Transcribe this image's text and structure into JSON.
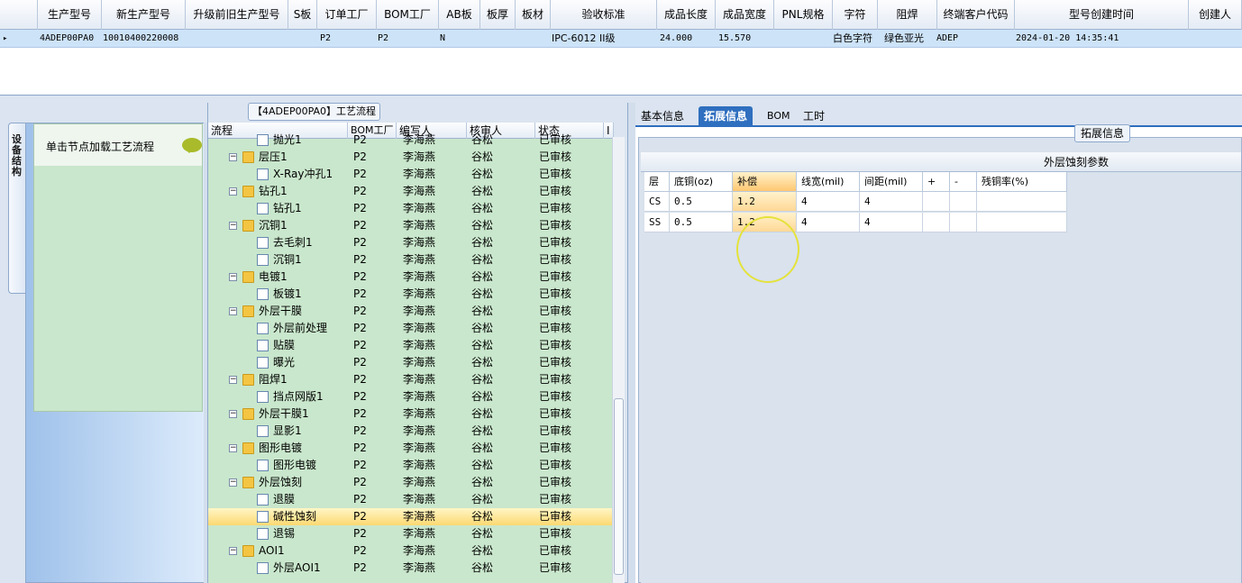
{
  "top_grid": {
    "columns": [
      "生产型号",
      "新生产型号",
      "升级前旧生产型号",
      "S板",
      "订单工厂",
      "BOM工厂",
      "AB板",
      "板厚",
      "板材",
      "验收标准",
      "成品长度",
      "成品宽度",
      "PNL规格",
      "字符",
      "阻焊",
      "终端客户代码",
      "型号创建时间",
      "创建人"
    ],
    "row": [
      "4ADEP00PA0",
      "10010400220008",
      "",
      "",
      "P2",
      "P2",
      "N",
      "",
      "",
      "IPC-6012 II级",
      "24.000",
      "15.570",
      "",
      "白色字符",
      "绿色亚光",
      "ADEP",
      "2024-01-20 14:35:41",
      ""
    ]
  },
  "side_tab": {
    "label": "设备结构"
  },
  "left_pane": {
    "hint": "单击节点加载工艺流程"
  },
  "flow": {
    "title": "【4ADEP00PA0】工艺流程",
    "columns": [
      "流程",
      "BOM工厂",
      "编写人",
      "核审人",
      "状态",
      "I"
    ],
    "rows": [
      {
        "level": 1,
        "name": "抛光1",
        "bom": "P2",
        "writer": "李海燕",
        "reviewer": "谷松",
        "status": "已审核"
      },
      {
        "level": 0,
        "name": "层压1",
        "bom": "P2",
        "writer": "李海燕",
        "reviewer": "谷松",
        "status": "已审核"
      },
      {
        "level": 1,
        "name": "X-Ray冲孔1",
        "bom": "P2",
        "writer": "李海燕",
        "reviewer": "谷松",
        "status": "已审核"
      },
      {
        "level": 0,
        "name": "钻孔1",
        "bom": "P2",
        "writer": "李海燕",
        "reviewer": "谷松",
        "status": "已审核"
      },
      {
        "level": 1,
        "name": "钻孔1",
        "bom": "P2",
        "writer": "李海燕",
        "reviewer": "谷松",
        "status": "已审核"
      },
      {
        "level": 0,
        "name": "沉铜1",
        "bom": "P2",
        "writer": "李海燕",
        "reviewer": "谷松",
        "status": "已审核"
      },
      {
        "level": 1,
        "name": "去毛刺1",
        "bom": "P2",
        "writer": "李海燕",
        "reviewer": "谷松",
        "status": "已审核"
      },
      {
        "level": 1,
        "name": "沉铜1",
        "bom": "P2",
        "writer": "李海燕",
        "reviewer": "谷松",
        "status": "已审核"
      },
      {
        "level": 0,
        "name": "电镀1",
        "bom": "P2",
        "writer": "李海燕",
        "reviewer": "谷松",
        "status": "已审核"
      },
      {
        "level": 1,
        "name": "板镀1",
        "bom": "P2",
        "writer": "李海燕",
        "reviewer": "谷松",
        "status": "已审核"
      },
      {
        "level": 0,
        "name": "外层干膜",
        "bom": "P2",
        "writer": "李海燕",
        "reviewer": "谷松",
        "status": "已审核"
      },
      {
        "level": 1,
        "name": "外层前处理",
        "bom": "P2",
        "writer": "李海燕",
        "reviewer": "谷松",
        "status": "已审核"
      },
      {
        "level": 1,
        "name": "贴膜",
        "bom": "P2",
        "writer": "李海燕",
        "reviewer": "谷松",
        "status": "已审核"
      },
      {
        "level": 1,
        "name": "曝光",
        "bom": "P2",
        "writer": "李海燕",
        "reviewer": "谷松",
        "status": "已审核"
      },
      {
        "level": 0,
        "name": "阻焊1",
        "bom": "P2",
        "writer": "李海燕",
        "reviewer": "谷松",
        "status": "已审核"
      },
      {
        "level": 1,
        "name": "挡点网版1",
        "bom": "P2",
        "writer": "李海燕",
        "reviewer": "谷松",
        "status": "已审核"
      },
      {
        "level": 0,
        "name": "外层干膜1",
        "bom": "P2",
        "writer": "李海燕",
        "reviewer": "谷松",
        "status": "已审核"
      },
      {
        "level": 1,
        "name": "显影1",
        "bom": "P2",
        "writer": "李海燕",
        "reviewer": "谷松",
        "status": "已审核"
      },
      {
        "level": 0,
        "name": "图形电镀",
        "bom": "P2",
        "writer": "李海燕",
        "reviewer": "谷松",
        "status": "已审核"
      },
      {
        "level": 1,
        "name": "图形电镀",
        "bom": "P2",
        "writer": "李海燕",
        "reviewer": "谷松",
        "status": "已审核"
      },
      {
        "level": 0,
        "name": "外层蚀刻",
        "bom": "P2",
        "writer": "李海燕",
        "reviewer": "谷松",
        "status": "已审核"
      },
      {
        "level": 1,
        "name": "退膜",
        "bom": "P2",
        "writer": "李海燕",
        "reviewer": "谷松",
        "status": "已审核"
      },
      {
        "level": 1,
        "name": "碱性蚀刻",
        "bom": "P2",
        "writer": "李海燕",
        "reviewer": "谷松",
        "status": "已审核",
        "selected": true
      },
      {
        "level": 1,
        "name": "退锡",
        "bom": "P2",
        "writer": "李海燕",
        "reviewer": "谷松",
        "status": "已审核"
      },
      {
        "level": 0,
        "name": "AOI1",
        "bom": "P2",
        "writer": "李海燕",
        "reviewer": "谷松",
        "status": "已审核"
      },
      {
        "level": 1,
        "name": "外层AOI1",
        "bom": "P2",
        "writer": "李海燕",
        "reviewer": "谷松",
        "status": "已审核"
      }
    ]
  },
  "tabs": [
    "基本信息",
    "拓展信息",
    "BOM",
    "工时"
  ],
  "active_tab": "拓展信息",
  "ext": {
    "group_label": "拓展信息",
    "table_title": "外层蚀刻参数",
    "columns": [
      "层",
      "底铜(oz)",
      "补偿",
      "线宽(mil)",
      "间距(mil)",
      "+",
      "-",
      "残铜率(%)"
    ],
    "rows": [
      [
        "CS",
        "0.5",
        "1.2",
        "4",
        "4",
        "",
        "",
        ""
      ],
      [
        "SS",
        "0.5",
        "1.2",
        "4",
        "4",
        "",
        "",
        ""
      ]
    ]
  },
  "colors": {
    "accent": "#2f6fbf",
    "tree_bg": "#c9e7cc",
    "selection": "#fcd972",
    "highlight_circle": "#e4e23a"
  }
}
